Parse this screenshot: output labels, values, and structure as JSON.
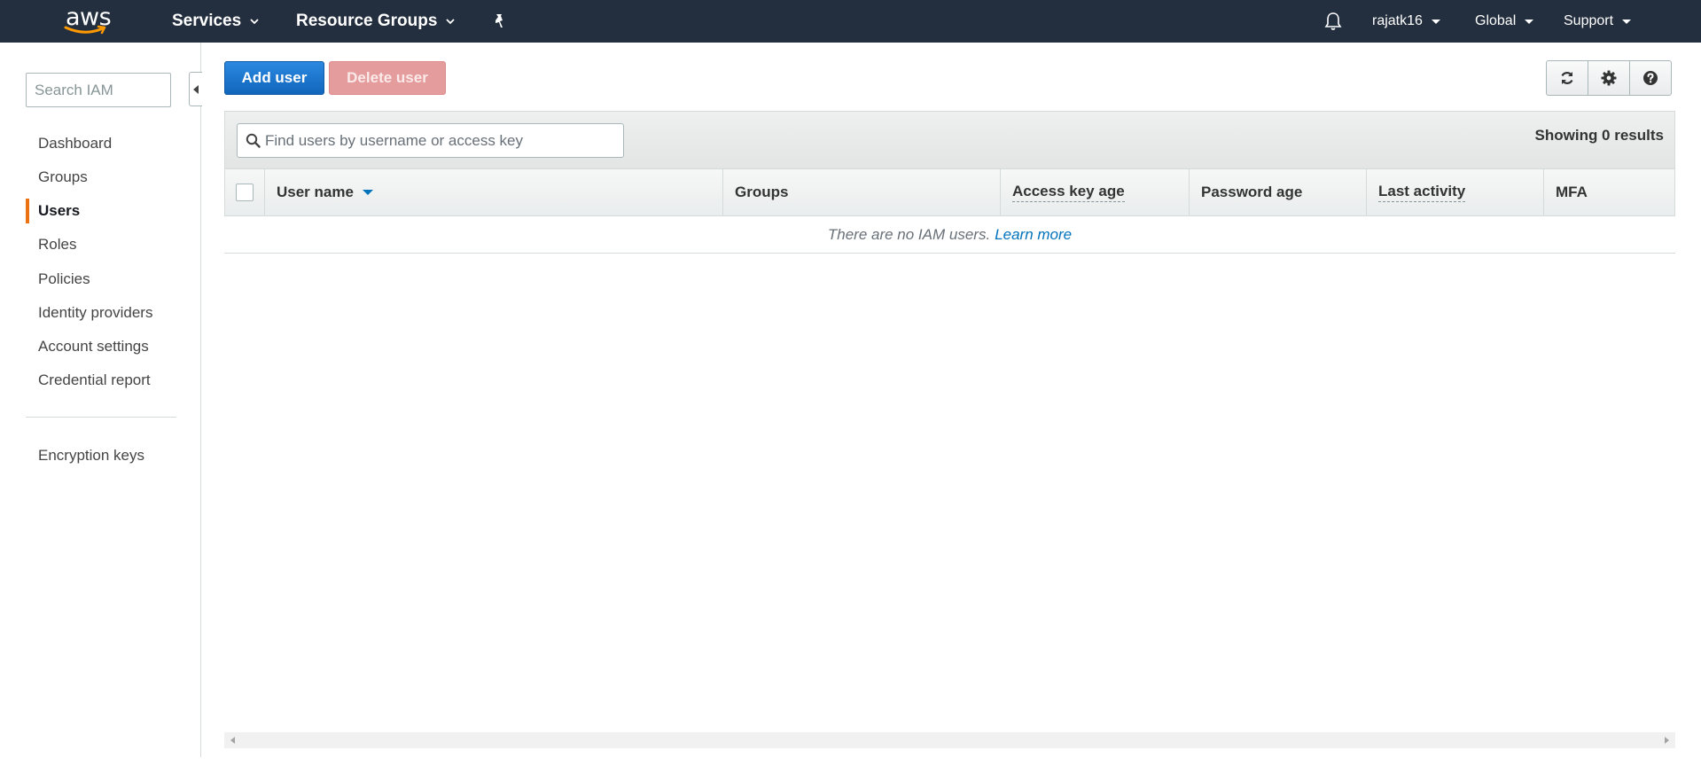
{
  "topnav": {
    "logo_text": "aws",
    "services_label": "Services",
    "resource_groups_label": "Resource Groups",
    "user_label": "rajatk16",
    "region_label": "Global",
    "support_label": "Support",
    "icons": [
      "chevron-down-icon",
      "pin-icon",
      "bell-icon",
      "caret-down-icon"
    ]
  },
  "sidebar": {
    "search_placeholder": "Search IAM",
    "items": [
      {
        "label": "Dashboard"
      },
      {
        "label": "Groups"
      },
      {
        "label": "Users",
        "active": true
      },
      {
        "label": "Roles"
      },
      {
        "label": "Policies"
      },
      {
        "label": "Identity providers"
      },
      {
        "label": "Account settings"
      },
      {
        "label": "Credential report"
      }
    ],
    "secondary_items": [
      {
        "label": "Encryption keys"
      }
    ]
  },
  "toolbar": {
    "add_user_label": "Add user",
    "delete_user_label": "Delete user",
    "icon_buttons": [
      "refresh-icon",
      "gear-icon",
      "help-icon"
    ]
  },
  "table": {
    "search_placeholder": "Find users by username or access key",
    "results_text": "Showing 0 results",
    "columns": [
      "User name",
      "Groups",
      "Access key age",
      "Password age",
      "Last activity",
      "MFA"
    ],
    "empty_text": "There are no IAM users.",
    "learn_more_label": "Learn more"
  },
  "colors": {
    "nav_bg": "#232f3e",
    "accent_orange": "#ec7211",
    "primary_blue": "#1166bb",
    "link_blue": "#0073bb",
    "disabled_red": "#e59c9c"
  }
}
